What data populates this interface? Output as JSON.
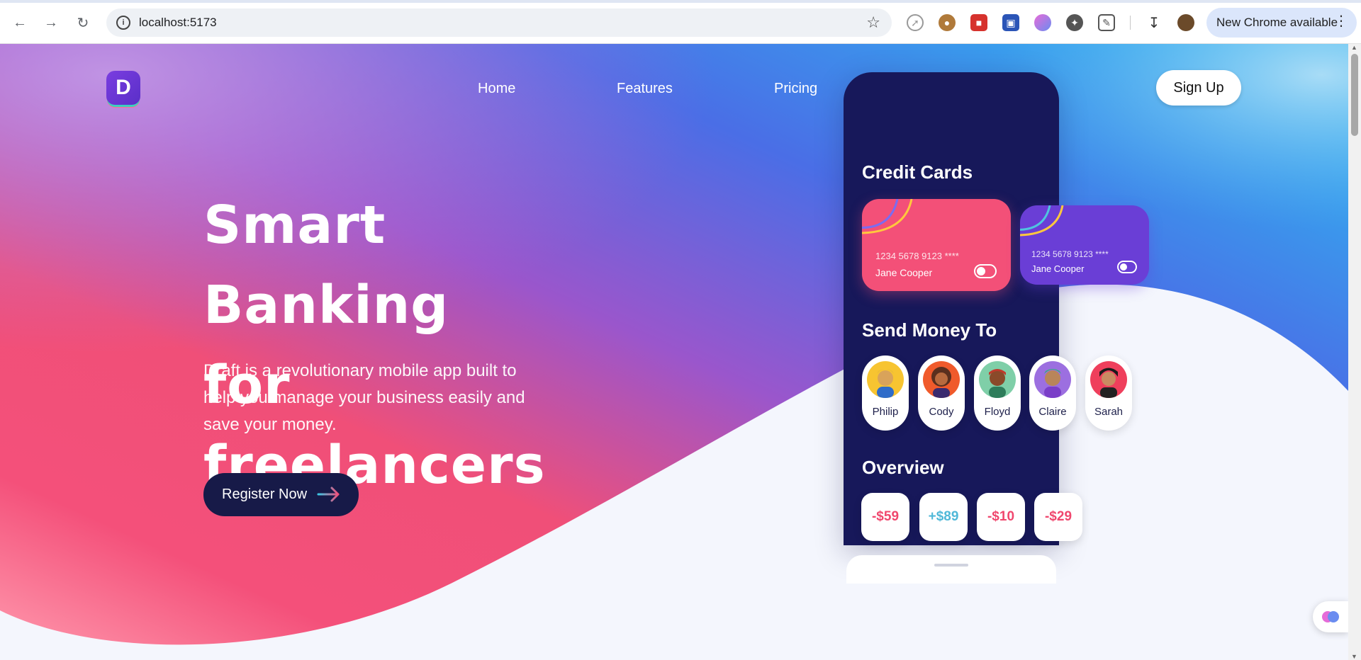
{
  "browser": {
    "url": "localhost:5173",
    "update_label": "New Chrome available"
  },
  "nav": {
    "logo_letter": "D",
    "links": [
      "Home",
      "Features",
      "Pricing"
    ],
    "signup_label": "Sign Up"
  },
  "hero": {
    "title_line1": "Smart Banking",
    "title_line2": "for freelancers",
    "subtitle": "Draft is a revolutionary mobile app built to help you manage your business easily and save your money.",
    "cta_label": "Register Now"
  },
  "phone": {
    "credit_cards_title": "Credit Cards",
    "cards": [
      {
        "number": "1234 5678 9123 ****",
        "holder": "Jane Cooper",
        "color": "#f35078"
      },
      {
        "number": "1234 5678 9123 ****",
        "holder": "Jane Cooper",
        "color": "#6a3ed6"
      }
    ],
    "send_money_title": "Send Money To",
    "contacts": [
      "Philip",
      "Cody",
      "Floyd",
      "Claire",
      "Sarah"
    ],
    "overview_title": "Overview",
    "overview": [
      {
        "amount": "-$59",
        "color": "#f0476e"
      },
      {
        "amount": "+$89",
        "color": "#4fb8d8"
      },
      {
        "amount": "-$10",
        "color": "#f0476e"
      },
      {
        "amount": "-$29",
        "color": "#f0476e"
      }
    ]
  },
  "colors": {
    "accent_navy": "#171a48",
    "pink": "#f35078",
    "purple": "#7b4fd6",
    "sky": "#2bb6ef"
  }
}
